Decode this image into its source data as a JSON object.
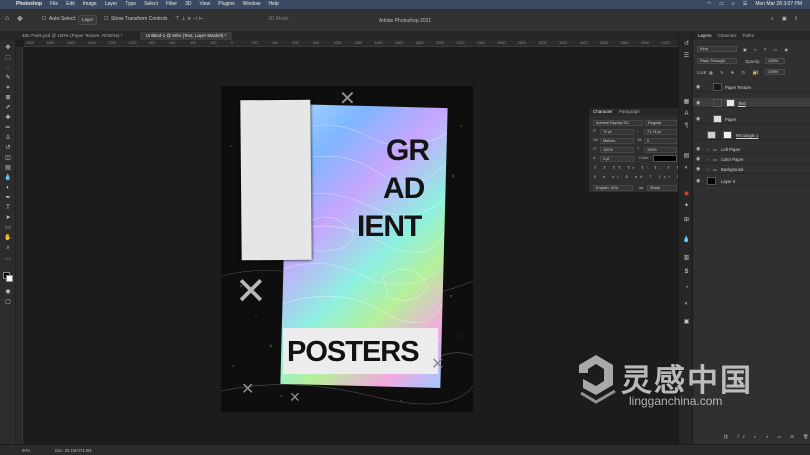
{
  "colors": {
    "menubar": "#3a4a63",
    "canvas": "#1c1c1c",
    "panel": "#303030",
    "accent": "#e34b2b"
  },
  "menubar": {
    "app_name": "Photoshop",
    "items": [
      "File",
      "Edit",
      "Image",
      "Layer",
      "Type",
      "Select",
      "Filter",
      "3D",
      "View",
      "Plugins",
      "Window",
      "Help"
    ],
    "clock": "Mon Mar 28  3:07 PM"
  },
  "window_title": "Adobe Photoshop 2021",
  "options": {
    "auto_select": "Auto-Select:",
    "auto_select_target": "Layer",
    "show_transform": "Show Transform Controls",
    "mode_3d": "3D Mode:"
  },
  "tabs": [
    {
      "label": "48K Parts.psd @ 100% (Paper Texture, RGB/16) *"
    },
    {
      "label": "Untitled-1 @ 50% (Text, Layer Mask/8) *"
    }
  ],
  "ruler_ticks": [
    "2000",
    "1800",
    "1600",
    "1400",
    "1200",
    "1000",
    "800",
    "600",
    "400",
    "200",
    "0",
    "200",
    "400",
    "600",
    "800",
    "1000",
    "1200",
    "1400",
    "1600",
    "1800",
    "2000",
    "2200",
    "2400",
    "2600",
    "2800",
    "3000",
    "3200",
    "3400",
    "3600",
    "3800",
    "4000",
    "4200"
  ],
  "poster": {
    "line1": "GR",
    "line2": "AD",
    "line3": "IENT",
    "bottom": "POSTERS"
  },
  "character": {
    "tab_character": "Character",
    "tab_paragraph": "Paragraph",
    "font_family": "Admiral Display SG",
    "font_style": "Regular",
    "font_size": "72 pt",
    "leading": "71.74 pt",
    "kerning": "Metrics",
    "tracking": "0",
    "vscale": "100%",
    "hscale": "100%",
    "baseline": "0 pt",
    "color_label": "Color:",
    "language": "English: USA",
    "antialias": "Sharp"
  },
  "layers_panel": {
    "tabs": [
      "Layers",
      "Channels",
      "Paths"
    ],
    "filter": "Kind",
    "blend_mode": "Pass Through",
    "opacity_label": "Opacity:",
    "opacity": "100%",
    "lock_label": "Lock:",
    "fill_label": "Fill:",
    "fill": "100%",
    "layers": [
      {
        "name": "Paper Texture",
        "thumb": "#1a1a1a"
      },
      {
        "name": "Text",
        "thumb": "#e9e9e9"
      },
      {
        "name": "Paper",
        "thumb": "#dcdcdc"
      },
      {
        "name": "Rectangle 1",
        "thumb": "#cfcfcf"
      },
      {
        "name": "Left Paper",
        "thumb": ""
      },
      {
        "name": "Color Paper",
        "thumb": ""
      },
      {
        "name": "Background",
        "thumb": ""
      },
      {
        "name": "Layer 4",
        "thumb": "#050505"
      }
    ]
  },
  "status": {
    "zoom": "50%",
    "doc": "Doc: 25.1M/474.8M"
  },
  "watermark": {
    "cn": "灵感中国",
    "en": "lingganchina.com"
  }
}
